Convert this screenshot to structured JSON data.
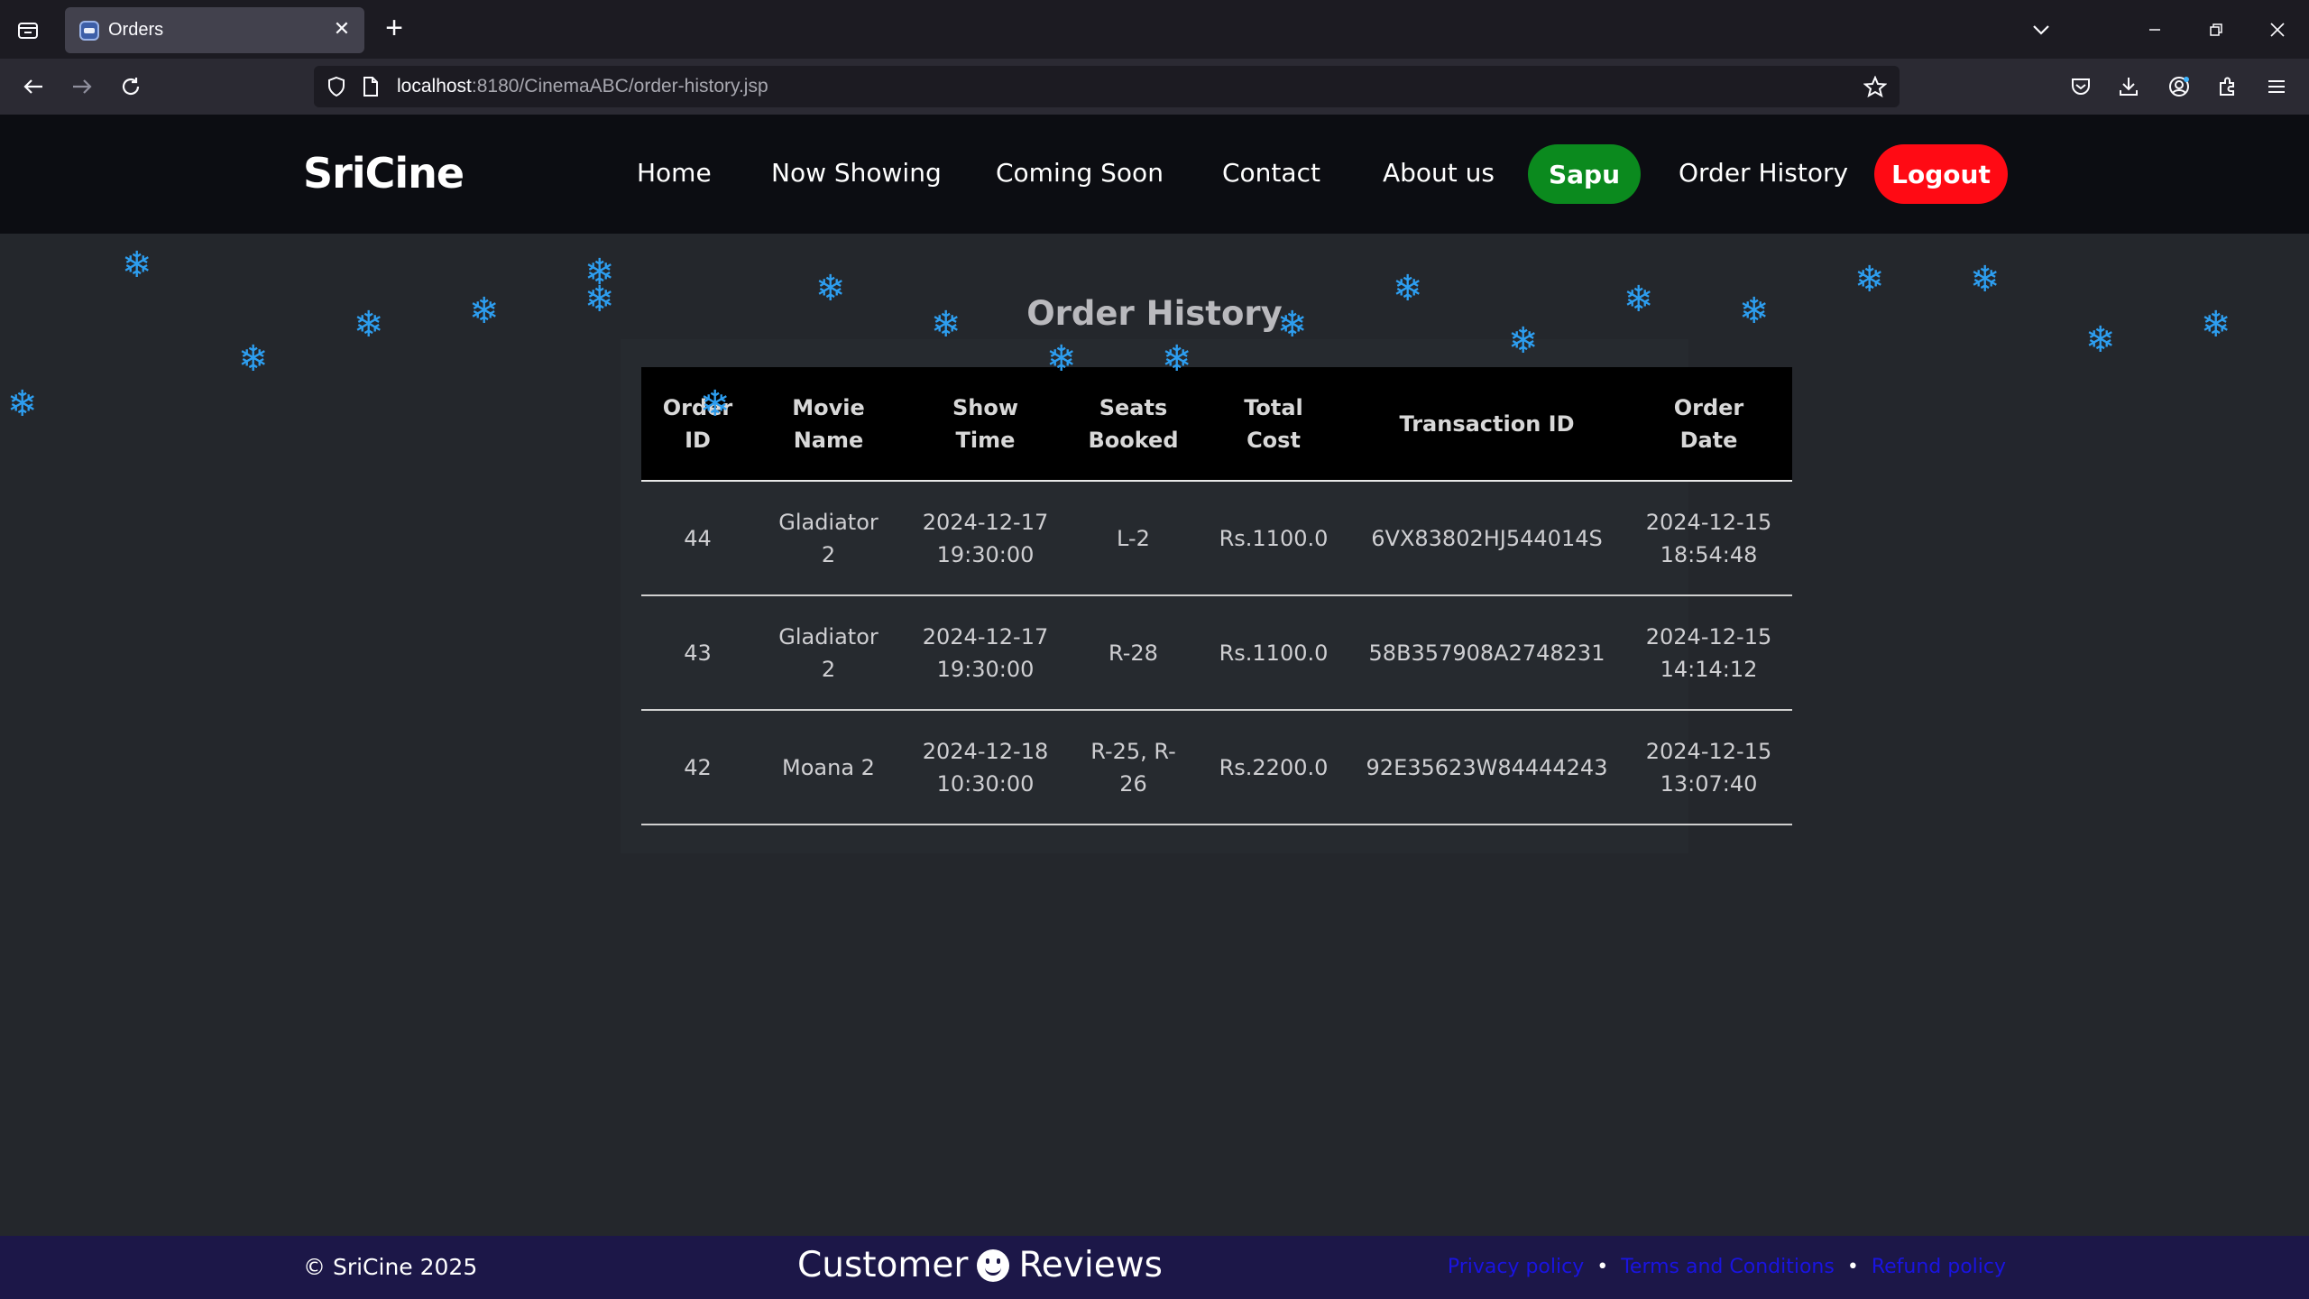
{
  "browser": {
    "tab_title": "Orders",
    "url_host": "localhost",
    "url_rest": ":8180/CinemaABC/order-history.jsp"
  },
  "site": {
    "brand": "SriCine",
    "nav": {
      "home": "Home",
      "now_showing": "Now Showing",
      "coming_soon": "Coming Soon",
      "contact": "Contact",
      "about": "About us",
      "user": "Sapu",
      "order_history": "Order History",
      "logout": "Logout"
    }
  },
  "main": {
    "title": "Order History",
    "table": {
      "headers": {
        "order_id": [
          "Order",
          "ID"
        ],
        "movie": [
          "Movie",
          "Name"
        ],
        "show": [
          "Show",
          "Time"
        ],
        "seats": [
          "Seats",
          "Booked"
        ],
        "cost": [
          "Total",
          "Cost"
        ],
        "txn": "Transaction ID",
        "date": [
          "Order",
          "Date"
        ]
      },
      "rows": [
        {
          "id": "44",
          "movie": [
            "Gladiator",
            "2"
          ],
          "show": [
            "2024-12-17",
            "19:30:00"
          ],
          "seats": "L-2",
          "cost": "Rs.1100.0",
          "txn": "6VX83802HJ544014S",
          "date": [
            "2024-12-15",
            "18:54:48"
          ]
        },
        {
          "id": "43",
          "movie": [
            "Gladiator",
            "2"
          ],
          "show": [
            "2024-12-17",
            "19:30:00"
          ],
          "seats": "R-28",
          "cost": "Rs.1100.0",
          "txn": "58B357908A2748231",
          "date": [
            "2024-12-15",
            "14:14:12"
          ]
        },
        {
          "id": "42",
          "movie": [
            "Moana 2",
            ""
          ],
          "show": [
            "2024-12-18",
            "10:30:00"
          ],
          "seats": "R-25, R-26",
          "cost": "Rs.2200.0",
          "txn": "92E35623W84444243",
          "date": [
            "2024-12-15",
            "13:07:40"
          ]
        }
      ]
    }
  },
  "footer": {
    "copyright": "© SriCine 2025",
    "reviews_left": "Customer",
    "reviews_right": "Reviews",
    "links": {
      "privacy": "Privacy policy",
      "terms": "Terms and Conditions",
      "refund": "Refund policy"
    },
    "separator": "•"
  },
  "colors": {
    "user_pill": "#0b8a1e",
    "logout_pill": "#ff0a14",
    "snowflake": "#2d9ef0",
    "footer_bg": "#1c1748",
    "footer_link": "#1a14e0"
  }
}
